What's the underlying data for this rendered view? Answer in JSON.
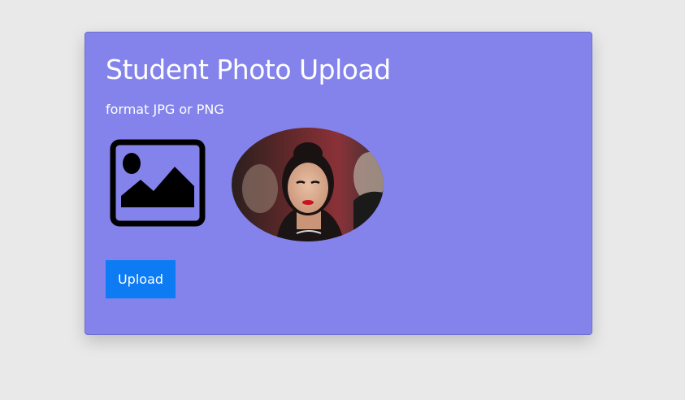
{
  "card": {
    "title": "Student Photo Upload",
    "subtitle": "format JPG or PNG",
    "upload_label": "Upload",
    "placeholder_icon": "image-placeholder-icon",
    "photo_alt": "student photo preview"
  },
  "colors": {
    "page_background": "#e9e9e9",
    "card_background": "#8383eb",
    "button_background": "#0d7bf4",
    "text": "#ffffff"
  }
}
